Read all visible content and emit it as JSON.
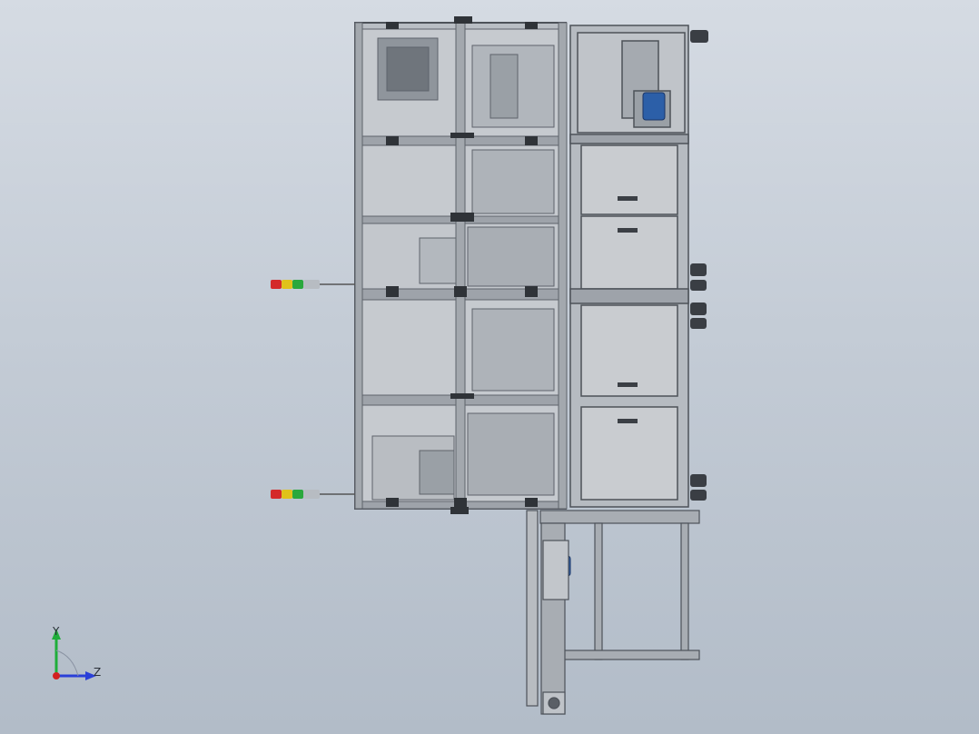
{
  "viewport": {
    "background_top": "#d5dbe3",
    "background_bottom": "#b2bcc8"
  },
  "triad": {
    "y_label": "Y",
    "z_label": "Z",
    "y_color": "#1fae3a",
    "z_color": "#2a3fd8",
    "x_color": "#d22020"
  },
  "model": {
    "frame_color": "#8d9299",
    "panel_color": "#c9ccd0",
    "motor_color": "#2c5fa8",
    "signal_tower_colors": [
      "#d42a2a",
      "#e0c21a",
      "#2aa83c",
      "#b7bcc2"
    ]
  }
}
